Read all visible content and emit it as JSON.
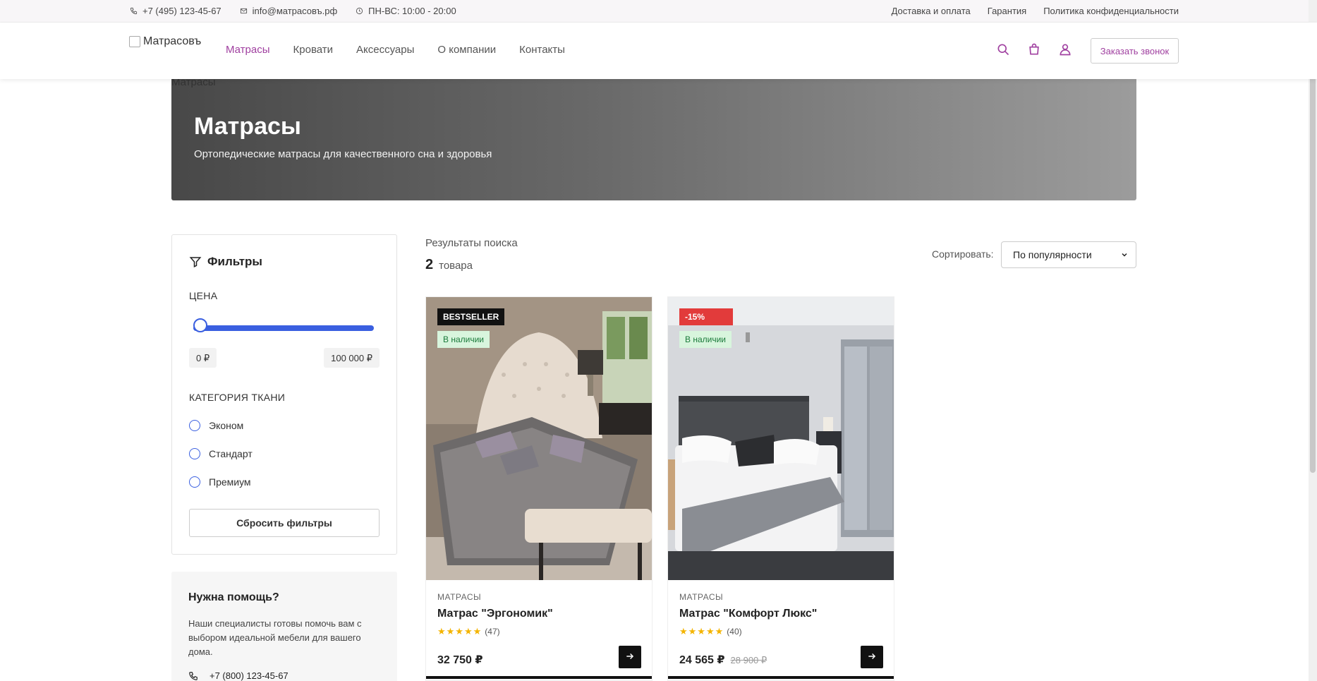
{
  "topbar": {
    "phone": "+7 (495) 123-45-67",
    "email": "info@матрасовъ.рф",
    "hours": "ПН-ВС: 10:00 - 20:00",
    "links": [
      "Доставка и оплата",
      "Гарантия",
      "Политика конфиденциальности"
    ]
  },
  "header": {
    "logo_alt": "Матрасовъ",
    "nav": [
      "Матрасы",
      "Кровати",
      "Аксессуары",
      "О компании",
      "Контакты"
    ],
    "active_nav": "Матрасы",
    "call_button": "Заказать звонок",
    "icons": [
      "search-icon",
      "cart-icon",
      "user-icon"
    ],
    "accent_color": "#a040a0"
  },
  "hero": {
    "image_alt": "Матрасы",
    "title": "Матрасы",
    "subtitle": "Ортопедические матрасы для качественного сна и здоровья"
  },
  "filters": {
    "title": "Фильтры",
    "price_label": "ЦЕНА",
    "price_min": "0 ₽",
    "price_max": "100 000 ₽",
    "slider_color": "#3a5fe0",
    "fabric_label": "КАТЕГОРИЯ ТКАНИ",
    "fabric_options": [
      "Эконом",
      "Стандарт",
      "Премиум"
    ],
    "reset_button": "Сбросить фильтры"
  },
  "help": {
    "title": "Нужна помощь?",
    "text": "Наши специалисты готовы помочь вам с выбором идеальной мебели для вашего дома.",
    "phone": "+7 (800) 123-45-67"
  },
  "results": {
    "title": "Результаты поиска",
    "count": "2",
    "count_label": "товара",
    "sort_label": "Сортировать:",
    "sort_value": "По популярности"
  },
  "products": [
    {
      "badge": "BESTSELLER",
      "badge_color": "#111111",
      "stock": "В наличии",
      "category": "МАТРАСЫ",
      "name": "Матрас \"Эргономик\"",
      "stars": "★★★★★",
      "reviews": "(47)",
      "price": "32 750 ₽",
      "old_price": ""
    },
    {
      "badge": "-15%",
      "badge_color": "#e23b3b",
      "stock": "В наличии",
      "category": "МАТРАСЫ",
      "name": "Матрас \"Комфорт Люкс\"",
      "stars": "★★★★★",
      "reviews": "(40)",
      "price": "24 565 ₽",
      "old_price": "28 900 ₽"
    }
  ]
}
